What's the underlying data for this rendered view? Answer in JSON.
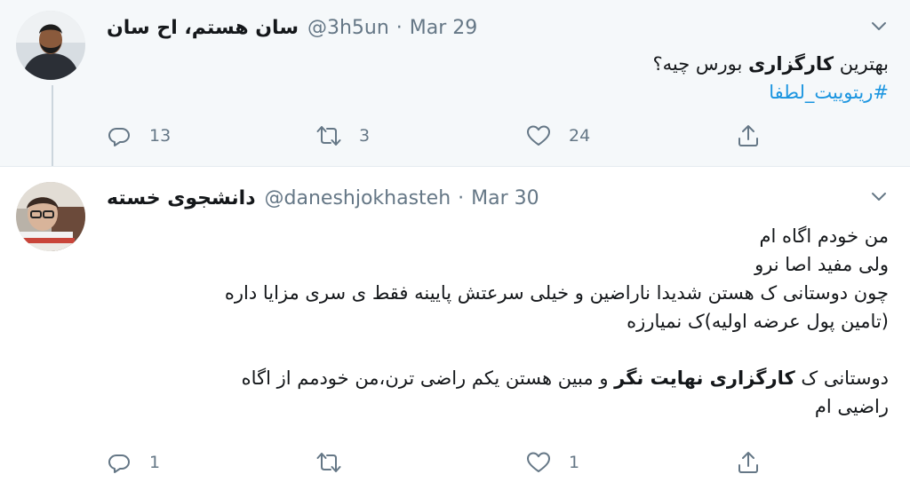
{
  "tweets": [
    {
      "author_name": "سان هستم، اح سان",
      "handle": "@3h5un",
      "separator": "·",
      "date": "Mar 29",
      "body": {
        "line1_pre": "بهترین ",
        "line1_bold": "کارگزاری",
        "line1_post": " بورس چیه؟",
        "hashtag": "#ریتوییت_لطفا"
      },
      "replies": "13",
      "retweets": "3",
      "likes": "24"
    },
    {
      "author_name": "دانشجوی خسته",
      "handle": "@daneshjokhasteh",
      "separator": "·",
      "date": "Mar 30",
      "body": {
        "line1": "من خودم اگاه ام",
        "line2": "ولی مفید اصا نرو",
        "line3": "چون دوستانی ک هستن شدیدا ناراضین و خیلی سرعتش پایینه فقط ی سری مزایا داره",
        "line4": "(تامین پول عرضه اولیه)ک نمیارزه",
        "line6_pre": "دوستانی ک ",
        "line6_bold": "کارگزاری نهایت نگر",
        "line6_post": " و مبین هستن یکم راضی ترن،من خودمم از اگاه",
        "line7": "راضیی ام"
      },
      "replies": "1",
      "retweets": "",
      "likes": "1"
    }
  ],
  "icons": {
    "reply": "reply-icon",
    "retweet": "retweet-icon",
    "like": "heart-icon",
    "share": "share-icon",
    "caret": "chevron-down-icon"
  },
  "colors": {
    "link": "#1b95e0",
    "secondary_text": "#657786",
    "highlight_bg": "#f5f8fa"
  }
}
